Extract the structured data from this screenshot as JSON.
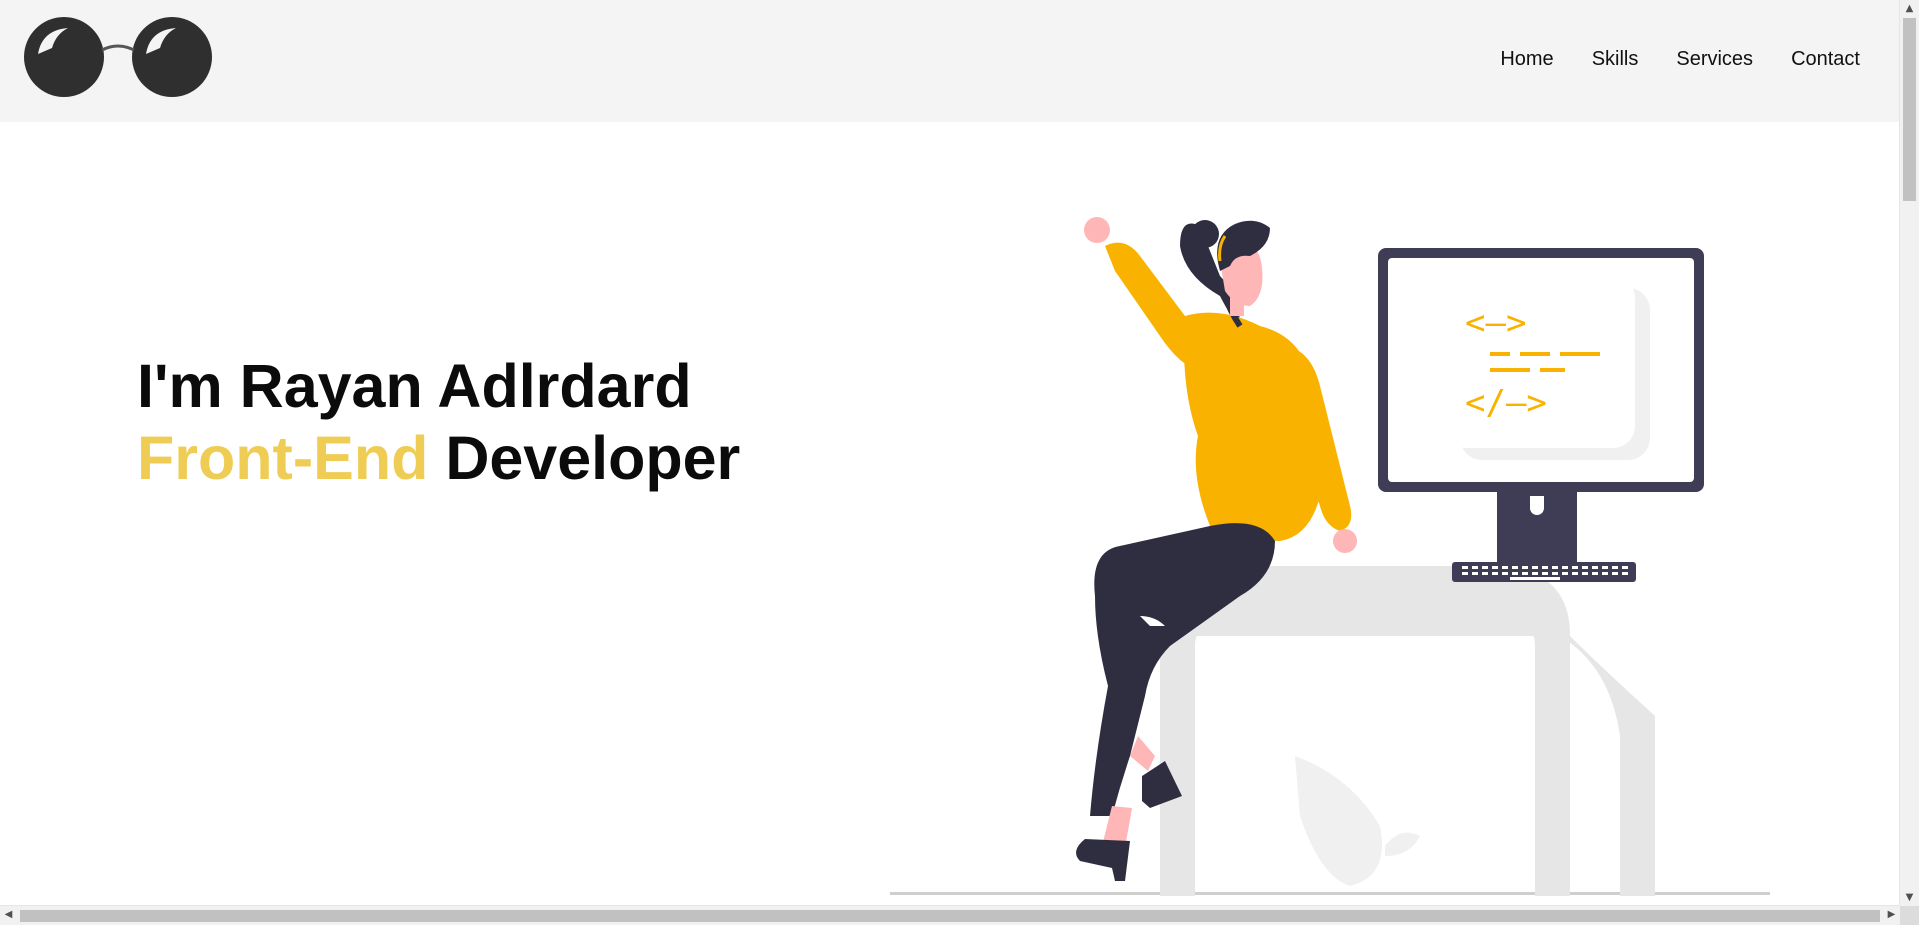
{
  "header": {
    "logo_icon": "glasses-icon",
    "nav": [
      {
        "label": "Home"
      },
      {
        "label": "Skills"
      },
      {
        "label": "Services"
      },
      {
        "label": "Contact"
      }
    ]
  },
  "hero": {
    "line1": "I'm Rayan Adlrdard",
    "accent": "Front-End",
    "role": "Developer",
    "accent_color": "#efcd55"
  },
  "illustration": {
    "icon": "woman-at-desk-illustration",
    "code_open": "<—>",
    "code_close": "</—>"
  },
  "scrollbars": {
    "vertical": "vertical-scrollbar",
    "horizontal": "horizontal-scrollbar"
  }
}
